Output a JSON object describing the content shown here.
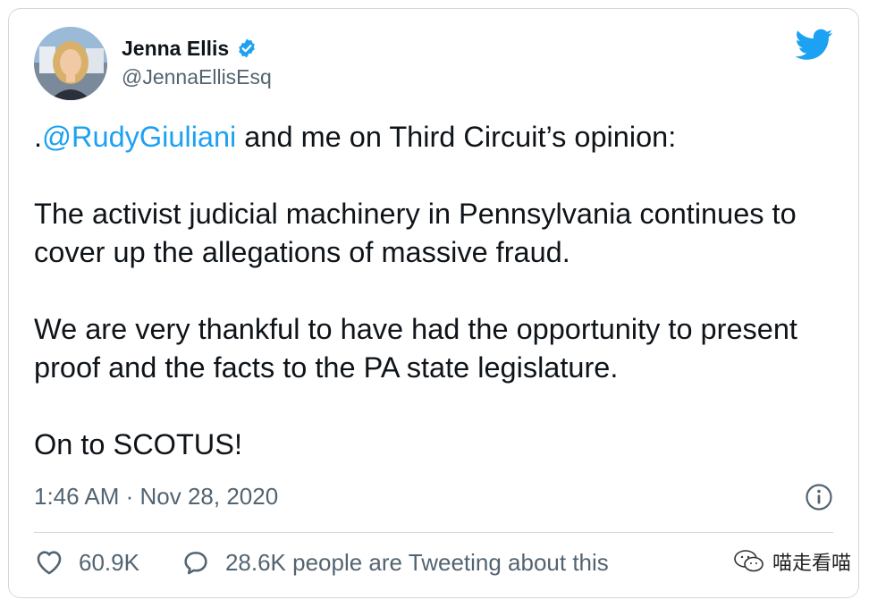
{
  "author": {
    "name": "Jenna Ellis",
    "handle": "@JennaEllisEsq",
    "verified": true
  },
  "tweet": {
    "line1_prefix": ".",
    "mention": "@RudyGiuliani",
    "line1_suffix": " and me on Third Circuit’s opinion:",
    "paragraph2": "The activist judicial machinery in Pennsylvania continues to cover up the allegations of massive fraud.",
    "paragraph3": "We are very thankful to have had the opportunity to present proof and the facts to the PA state legislature.",
    "paragraph4": "On to SCOTUS!"
  },
  "timestamp": "1:46 AM · Nov 28, 2020",
  "actions": {
    "likes": "60.9K",
    "replies_text": "28.6K people are Tweeting about this"
  },
  "watermark": {
    "text": "喵走看喵"
  },
  "icons": {
    "brand": "twitter-bird-icon",
    "verified": "verified-badge-icon",
    "info": "info-icon",
    "like": "heart-icon",
    "reply": "speech-bubble-icon",
    "watermark": "wechat-icon"
  },
  "colors": {
    "accent": "#1da1f2",
    "text": "#0f1419",
    "muted": "#536471",
    "border": "#cfd9de"
  }
}
